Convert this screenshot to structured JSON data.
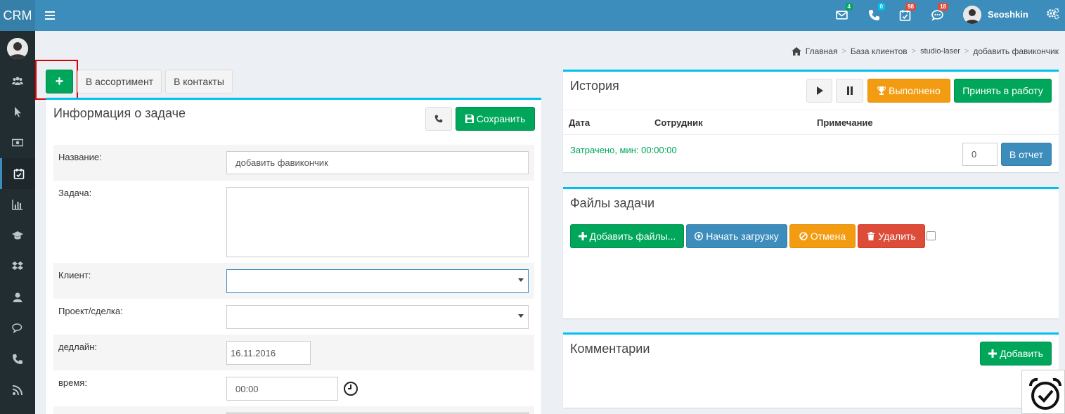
{
  "app": {
    "logo": "CRM"
  },
  "topbar": {
    "icons": [
      {
        "name": "envelope-icon",
        "badge": "4",
        "badge_color": "#00a65a"
      },
      {
        "name": "phone-icon",
        "badge": "0",
        "badge_color": "#00c0ef"
      },
      {
        "name": "calendar-check-icon",
        "badge": "98",
        "badge_color": "#dd4b39"
      },
      {
        "name": "comments-icon",
        "badge": "18",
        "badge_color": "#dd4b39"
      }
    ],
    "user_name": "Seoshkin"
  },
  "breadcrumb": {
    "items": [
      "Главная",
      "База клиентов",
      "studio-laser",
      "добавить фавикончик"
    ]
  },
  "toolbar": {
    "add_label": "+",
    "assortment_label": "В ассортимент",
    "contacts_label": "В контакты"
  },
  "task_info": {
    "title": "Информация о задаче",
    "save_label": "Сохранить",
    "fields": {
      "name_label": "Название:",
      "name_value": "добавить фавикончик",
      "task_label": "Задача:",
      "task_value": "",
      "client_label": "Клиент:",
      "client_value": "",
      "project_label": "Проект/сделка:",
      "project_value": "",
      "deadline_label": "дедлайн:",
      "deadline_value": "16.11.2016",
      "time_label": "время:",
      "time_value": "00:00"
    }
  },
  "history": {
    "title": "История",
    "done_label": "Выполнено",
    "accept_label": "Принять в работу",
    "columns": [
      "Дата",
      "Сотрудник",
      "Примечание"
    ],
    "spent_label": "Затрачено, мин: 00:00:00",
    "report_value": "0",
    "report_label": "В отчет"
  },
  "files": {
    "title": "Файлы задачи",
    "add_label": "Добавить файлы...",
    "upload_label": "Начать загрузку",
    "cancel_label": "Отмена",
    "delete_label": "Удалить"
  },
  "comments": {
    "title": "Комментарии",
    "add_label": "Добавить"
  },
  "colors": {
    "topbar": "#3c8dbc",
    "sidebar": "#222d32",
    "green": "#00a65a",
    "blue": "#3c8dbc",
    "orange": "#f39c12",
    "red": "#dd4b39",
    "box_accent": "#00c0ef",
    "spent_text": "#00a65a"
  }
}
